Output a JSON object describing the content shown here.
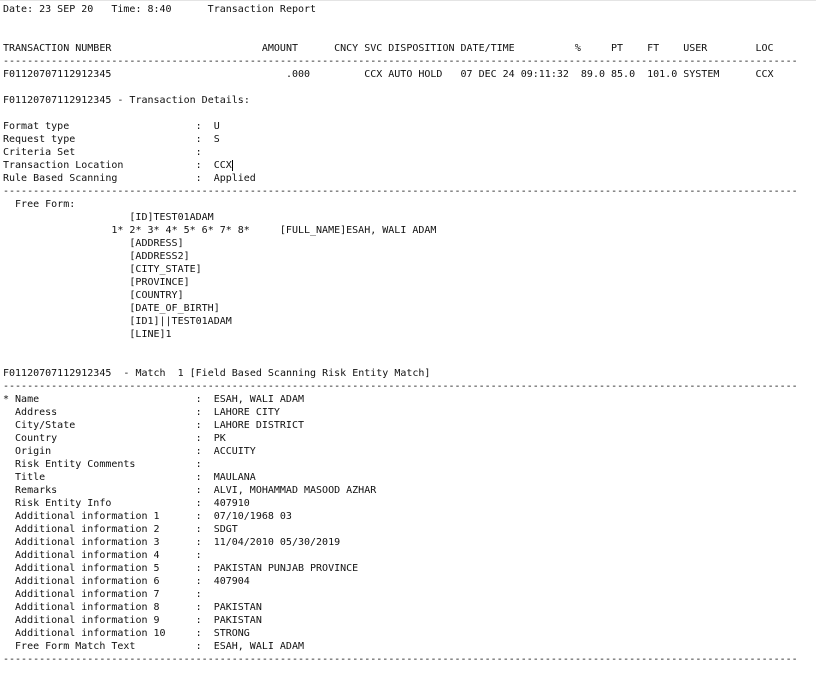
{
  "header": {
    "date_label": "Date: 23 SEP 20",
    "time_label": "Time: 8:40",
    "title": "Transaction Report"
  },
  "columns": [
    "TRANSACTION NUMBER",
    "AMOUNT",
    "CNCY",
    "SVC",
    "DISPOSITION",
    "DATE/TIME",
    "%",
    "PT",
    "FT",
    "USER",
    "LOC"
  ],
  "transaction": {
    "number": "F01120707112912345",
    "amount": ".000",
    "svc": "CCX",
    "disposition": "AUTO HOLD",
    "datetime": "07 DEC 24 09:11:32",
    "percent": "89.0",
    "pt": "85.0",
    "ft": "101.0",
    "user": "SYSTEM",
    "loc": "CCX"
  },
  "details": {
    "title": "F01120707112912345 - Transaction Details:",
    "fields": [
      {
        "label": "Format type",
        "value": "U"
      },
      {
        "label": "Request type",
        "value": "S"
      },
      {
        "label": "Criteria Set",
        "value": ""
      },
      {
        "label": "Transaction Location",
        "value": "CCX"
      },
      {
        "label": "Rule Based Scanning",
        "value": "Applied"
      }
    ]
  },
  "free_form": {
    "label": "Free Form:",
    "id_line": "[ID]TEST01ADAM",
    "markers": "1* 2* 3* 4* 5* 6* 7* 8*",
    "full_name": "[FULL_NAME]ESAH, WALI ADAM",
    "lines": [
      "[ADDRESS]",
      "[ADDRESS2]",
      "[CITY_STATE]",
      "[PROVINCE]",
      "[COUNTRY]",
      "[DATE_OF_BIRTH]",
      "[ID1]||TEST01ADAM",
      "[LINE]1"
    ]
  },
  "match": {
    "title": "F01120707112912345  - Match  1 [Field Based Scanning Risk Entity Match]",
    "fields": [
      {
        "label": "* Name",
        "value": "ESAH, WALI ADAM"
      },
      {
        "label": "Address",
        "value": "LAHORE CITY"
      },
      {
        "label": "City/State",
        "value": "LAHORE DISTRICT"
      },
      {
        "label": "Country",
        "value": "PK"
      },
      {
        "label": "Origin",
        "value": "ACCUITY"
      },
      {
        "label": "Risk Entity Comments",
        "value": ""
      },
      {
        "label": "Title",
        "value": "MAULANA"
      },
      {
        "label": "Remarks",
        "value": "ALVI, MOHAMMAD MASOOD AZHAR"
      },
      {
        "label": "Risk Entity Info",
        "value": "407910"
      },
      {
        "label": "Additional information 1",
        "value": "07/10/1968 03"
      },
      {
        "label": "Additional information 2",
        "value": "SDGT"
      },
      {
        "label": "Additional information 3",
        "value": "11/04/2010 05/30/2019"
      },
      {
        "label": "Additional information 4",
        "value": ""
      },
      {
        "label": "Additional information 5",
        "value": "PAKISTAN PUNJAB PROVINCE"
      },
      {
        "label": "Additional information 6",
        "value": "407904"
      },
      {
        "label": "Additional information 7",
        "value": ""
      },
      {
        "label": "Additional information 8",
        "value": "PAKISTAN"
      },
      {
        "label": "Additional information 9",
        "value": "PAKISTAN"
      },
      {
        "label": "Additional information 10",
        "value": "STRONG"
      },
      {
        "label": "Free Form Match Text",
        "value": "ESAH, WALI ADAM"
      }
    ]
  }
}
